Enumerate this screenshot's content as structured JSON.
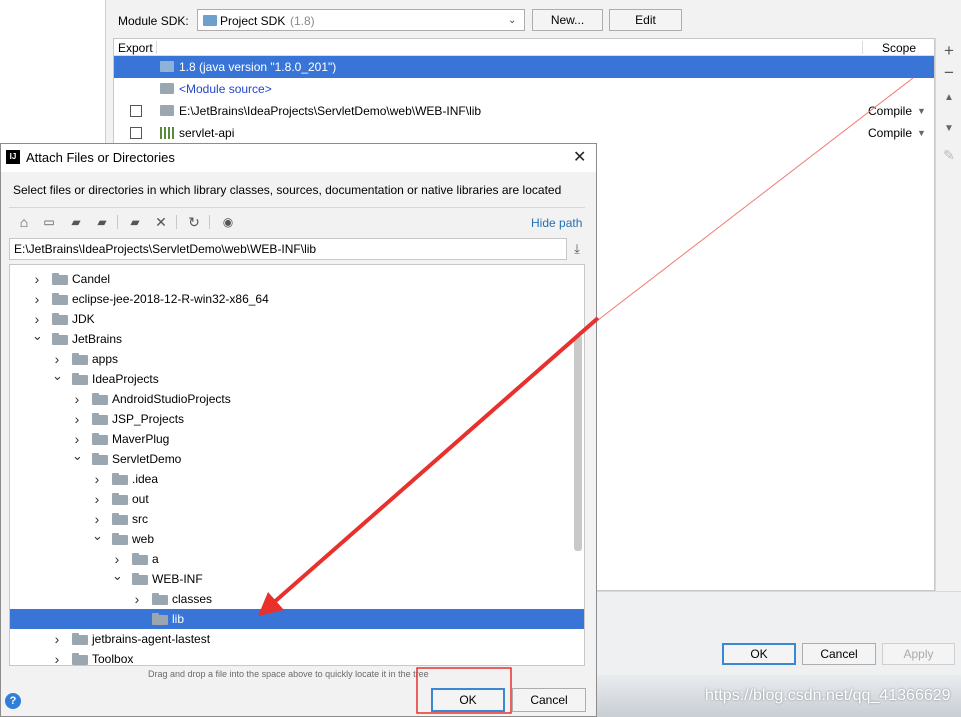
{
  "module": {
    "sdk_label": "Module SDK:",
    "sdk_value": "Project SDK",
    "sdk_version": "(1.8)",
    "new_button": "New...",
    "edit_button": "Edit"
  },
  "dependencies": {
    "headers": {
      "export": "Export",
      "scope": "Scope"
    },
    "rows": [
      {
        "name": "1.8 (java version \"1.8.0_201\")",
        "scope": ""
      },
      {
        "name": "<Module source>",
        "scope": ""
      },
      {
        "name": "E:\\JetBrains\\IdeaProjects\\ServletDemo\\web\\WEB-INF\\lib",
        "scope": "Compile"
      },
      {
        "name": "servlet-api",
        "scope": "Compile"
      }
    ]
  },
  "side_toolbar": {
    "add": "+",
    "remove": "−",
    "up": "▲",
    "down": "▼",
    "edit": "✎"
  },
  "background_buttons": {
    "ok": "OK",
    "cancel": "Cancel",
    "apply": "Apply"
  },
  "watermark": "https://blog.csdn.net/qq_41366629",
  "dialog": {
    "title": "Attach Files or Directories",
    "description": "Select files or directories in which library classes, sources, documentation or native libraries are located",
    "hide_path": "Hide path",
    "path_value": "E:\\JetBrains\\IdeaProjects\\ServletDemo\\web\\WEB-INF\\lib",
    "hint": "Drag and drop a file into the space above to quickly locate it in the tree",
    "ok_button": "OK",
    "cancel_button": "Cancel",
    "help": "?",
    "tree": [
      {
        "label": "Candel",
        "depth": 0,
        "expanded": false
      },
      {
        "label": "eclipse-jee-2018-12-R-win32-x86_64",
        "depth": 0,
        "expanded": false
      },
      {
        "label": "JDK",
        "depth": 0,
        "expanded": false
      },
      {
        "label": "JetBrains",
        "depth": 0,
        "expanded": true
      },
      {
        "label": "apps",
        "depth": 1,
        "expanded": false
      },
      {
        "label": "IdeaProjects",
        "depth": 1,
        "expanded": true
      },
      {
        "label": "AndroidStudioProjects",
        "depth": 2,
        "expanded": false
      },
      {
        "label": "JSP_Projects",
        "depth": 2,
        "expanded": false
      },
      {
        "label": "MaverPlug",
        "depth": 2,
        "expanded": false
      },
      {
        "label": "ServletDemo",
        "depth": 2,
        "expanded": true
      },
      {
        "label": ".idea",
        "depth": 3,
        "expanded": false
      },
      {
        "label": "out",
        "depth": 3,
        "expanded": false
      },
      {
        "label": "src",
        "depth": 3,
        "expanded": false
      },
      {
        "label": "web",
        "depth": 3,
        "expanded": true
      },
      {
        "label": "a",
        "depth": 4,
        "expanded": false
      },
      {
        "label": "WEB-INF",
        "depth": 4,
        "expanded": true
      },
      {
        "label": "classes",
        "depth": 5,
        "expanded": false
      },
      {
        "label": "lib",
        "depth": 5,
        "expanded": null,
        "selected": true
      },
      {
        "label": "jetbrains-agent-lastest",
        "depth": 1,
        "expanded": false
      },
      {
        "label": "Toolbox",
        "depth": 1,
        "expanded": false
      }
    ]
  },
  "colors": {
    "selection": "#3875d7",
    "link": "#2470b3",
    "annotation": "#e8302d"
  }
}
